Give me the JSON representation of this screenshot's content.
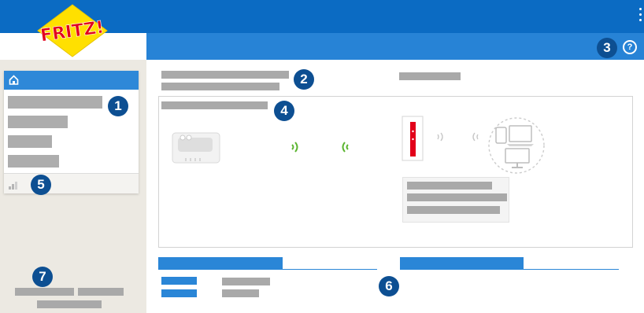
{
  "header": {
    "logo_text": "FRITZ!",
    "brand_colors": {
      "top": "#0b6bc3",
      "title": "#2783d6",
      "logo_red": "#e2001a",
      "logo_yellow": "#ffe000"
    },
    "help_glyph": "?",
    "help_icon": "help-circle-icon",
    "menu_icon": "kebab-menu-icon"
  },
  "badges": [
    "1",
    "2",
    "3",
    "4",
    "5",
    "6",
    "7"
  ],
  "sidebar": {
    "home_icon": "home-icon",
    "signal_icon": "signal-bars-icon"
  },
  "overview": {
    "modem_icon": "box-modem-icon",
    "wifi_out_icon": "wifi-waves-right-icon",
    "wifi_in_icon": "wifi-waves-left-icon",
    "router_icon": "fritzbox-router-icon",
    "devices_icon": "connected-devices-icon",
    "wifi_green": "#5cb531"
  }
}
